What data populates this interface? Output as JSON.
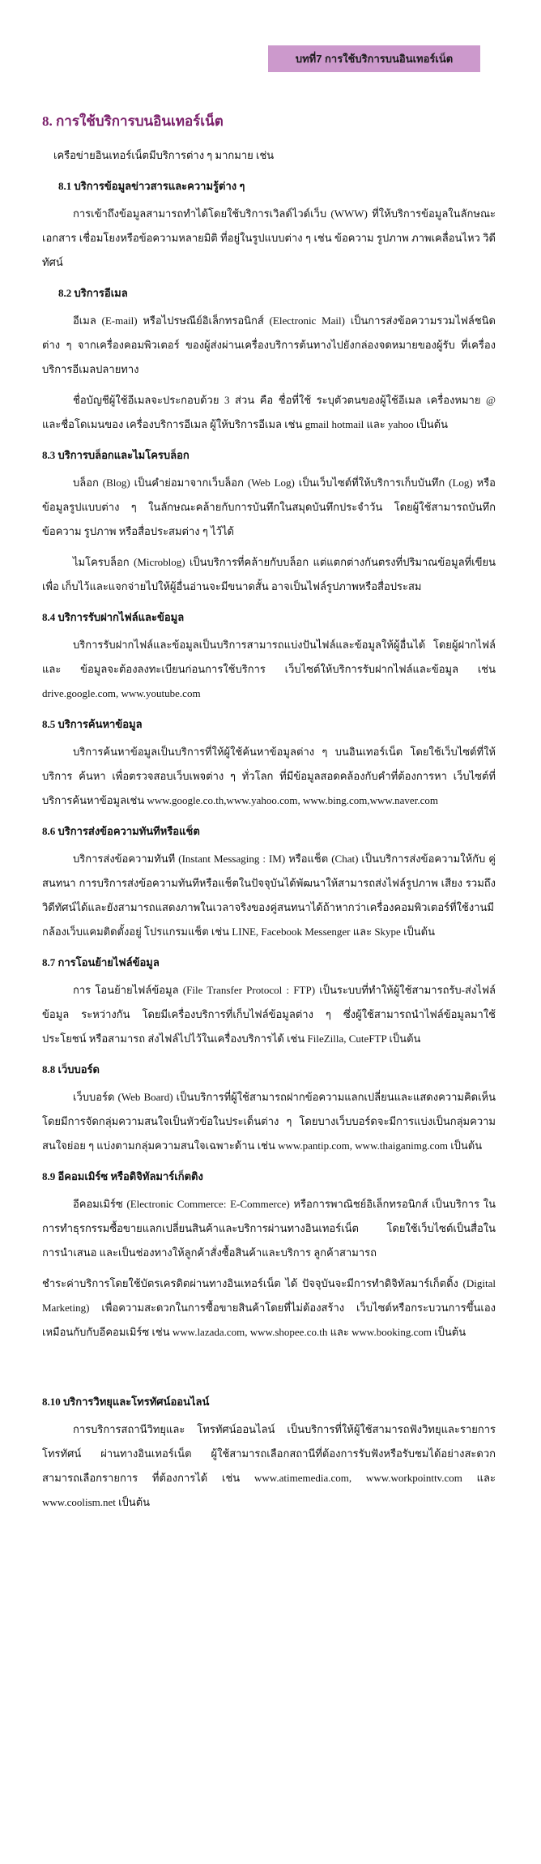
{
  "header": {
    "chapter": "บทที่7 การใช้บริการบนอินเทอร์เน็ต"
  },
  "section": {
    "title": "8. การใช้บริการบนอินเทอร์เน็ต",
    "intro": "เครือข่ายอินเทอร์เน็ตมีบริการต่าง ๆ มากมาย เช่น"
  },
  "s1": {
    "title": "8.1 บริการข้อมูลข่าวสารและความรู้ต่าง ๆ",
    "p1": "การเข้าถึงข้อมูลสามารถทำได้โดยใช้บริการเวิลด์ไวด์เว็บ (WWW) ที่ให้บริการข้อมูลในลักษณะเอกสาร เชื่อมโยงหรือข้อความหลายมิติ ที่อยู่ในรูปแบบต่าง ๆ เช่น ข้อความ รูปภาพ ภาพเคลื่อนไหว วิดีทัศน์"
  },
  "s2": {
    "title": "8.2 บริการอีเมล",
    "p1": "อีเมล (E-mail) หรือไปรษณีย์อิเล็กทรอนิกส์ (Electronic Mail) เป็นการส่งข้อความรวมไฟล์ชนิดต่าง ๆ จากเครื่องคอมพิวเตอร์ ของผู้ส่งผ่านเครื่องบริการต้นทางไปยังกล่องจดหมายของผู้รับ ที่เครื่องบริการอีเมลปลายทาง",
    "p2": "ชื่อบัญชีผู้ใช้อีเมลจะประกอบด้วย 3 ส่วน คือ ชื่อที่ใช้ ระบุตัวตนของผู้ใช้อีเมล เครื่องหมาย @ และชื่อโดเมนของ เครื่องบริการอีเมล ผู้ให้บริการอีเมล เช่น gmail hotmail และ yahoo เป็นต้น"
  },
  "s3": {
    "title": "8.3 บริการบล็อกและไมโครบล็อก",
    "p1": "บล็อก (Blog) เป็นคำย่อมาจากเว็บล็อก (Web Log) เป็นเว็บไซต์ที่ให้บริการเก็บบันทึก (Log) หรือ ข้อมูลรูปแบบต่าง ๆ ในลักษณะคล้ายกับการบันทึกในสมุดบันทึกประจำวัน โดยผู้ใช้สามารถบันทึกข้อความ รูปภาพ หรือสื่อประสมต่าง ๆ ไว้ได้",
    "p2": "ไมโครบล็อก (Microblog) เป็นบริการที่คล้ายกับบล็อก แต่แตกต่างกันตรงที่ปริมาณข้อมูลที่เขียนเพื่อ เก็บไว้และแจกจ่ายไปให้ผู้อื่นอ่านจะมีขนาดสั้น อาจเป็นไฟล์รูปภาพหรือสื่อประสม"
  },
  "s4": {
    "title": "8.4 บริการรับฝากไฟล์และข้อมูล",
    "p1": "บริการรับฝากไฟล์และข้อมูลเป็นบริการสามารถแบ่งปันไฟล์และข้อมูลให้ผู้อื่นได้ โดยผู้ฝากไฟล์และ ข้อมูลจะต้องลงทะเบียนก่อนการใช้บริการ เว็บไซต์ให้บริการรับฝากไฟล์และข้อมูล เช่น drive.google.com, www.youtube.com"
  },
  "s5": {
    "title": "8.5 บริการค้นหาข้อมูล",
    "p1": "บริการค้นหาข้อมูลเป็นบริการที่ให้ผู้ใช้ค้นหาข้อมูลต่าง ๆ บนอินเทอร์เน็ต โดยใช้เว็บไซต์ที่ให้บริการ ค้นหา เพื่อตรวจสอบเว็บเพจต่าง ๆ ทั่วโลก ที่มีข้อมูลสอดคล้องกับคำที่ต้องการหา เว็บไซต์ที่บริการค้นหาข้อมูลเช่น www.google.co.th,www.yahoo.com, www.bing.com,www.naver.com"
  },
  "s6": {
    "title": "8.6 บริการส่งข้อความทันทีหรือแช็ต",
    "p1": "บริการส่งข้อความทันที (Instant Messaging : IM) หรือแช็ต (Chat) เป็นบริการส่งข้อความให้กับ คู่สนทนา การบริการส่งข้อความทันทีหรือแช็ตในปัจจุบันได้พัฒนาให้สามารถส่งไฟล์รูปภาพ เสียง รวมถึงวิดีทัศน์ได้และยังสามารถแสดงภาพในเวลาจริงของคู่สนทนาได้ถ้าหากว่าเครื่องคอมพิวเตอร์ที่ใช้งานมีกล้องเว็บแคมติดตั้งอยู่ โปรแกรมแช็ต เช่น LINE, Facebook Messenger และ Skype เป็นต้น"
  },
  "s7": {
    "title": "8.7 การโอนย้ายไฟล์ข้อมูล",
    "p1": "การ โอนย้ายไฟล์ข้อมูล (File Transfer Protocol : FTP) เป็นระบบที่ทำให้ผู้ใช้สามารถรับ-ส่งไฟล์ข้อมูล ระหว่างกัน โดยมีเครื่องบริการที่เก็บไฟล์ข้อมูลต่าง ๆ ซึ่งผู้ใช้สามารถนำไฟล์ข้อมูลมาใช้ประโยชน์ หรือสามารถ ส่งไฟล์ไปไว้ในเครื่องบริการได้ เช่น FileZilla, CuteFTP เป็นต้น"
  },
  "s8": {
    "title": "8.8 เว็บบอร์ด",
    "p1": "เว็บบอร์ด (Web Board) เป็นบริการที่ผู้ใช้สามารถฝากข้อความแลกเปลี่ยนและแสดงความคิดเห็น โดยมีการจัดกลุ่มความสนใจเป็นหัวข้อในประเด็นต่าง ๆ โดยบางเว็บบอร์ดจะมีการแบ่งเป็นกลุ่มความสนใจย่อย ๆ แบ่งตามกลุ่มความสนใจเฉพาะด้าน เช่น www.pantip.com, www.thaiganimg.com เป็นต้น"
  },
  "s9": {
    "title": "8.9 อีคอมเมิร์ซ หรือดิจิทัลมาร์เก็ตติง",
    "p1": "อีคอมเมิร์ซ (Electronic Commerce: E-Commerce) หรือการพาณิชย์อิเล็กทรอนิกส์ เป็นบริการ ในการทำธุรกรรมซื้อขายแลกเปลี่ยนสินค้าและบริการผ่านทางอินเทอร์เน็ต โดยใช้เว็บไซต์เป็นสื่อในการนำเสนอ และเป็นช่องทางให้ลูกค้าสั่งซื้อสินค้าและบริการ ลูกค้าสามารถ",
    "p2": "ชำระค่าบริการโดยใช้บัตรเครดิตผ่านทางอินเทอร์เน็ต ได้ ปัจจุบันจะมีการทำดิจิทัลมาร์เก็ตติ้ง (Digital Marketing) เพื่อความสะดวกในการซื้อขายสินค้าโดยที่ไม่ต้องสร้าง เว็บไซต์หรือกระบวนการขึ้นเองเหมือนกับกับอีคอมเมิร์ซ เช่น www.lazada.com, www.shopee.co.th และ www.booking.com เป็นต้น"
  },
  "s10": {
    "title": "8.10 บริการวิทยุและโทรทัศน์ออนไลน์",
    "p1": "การบริการสถานีวิทยุและ โทรทัศน์ออนไลน์ เป็นบริการที่ให้ผู้ใช้สามารถฟังวิทยุและรายการ โทรทัศน์ ผ่านทางอินเทอร์เน็ต ผู้ใช้สามารถเลือกสถานีที่ต้องการรับฟังหรือรับชมได้อย่างสะดวก สามารถเลือกรายการ ที่ต้องการได้ เช่น www.atimemedia.com, www.workpointtv.com และ www.coolism.net เป็นต้น"
  }
}
